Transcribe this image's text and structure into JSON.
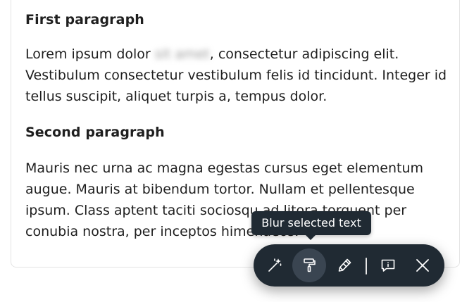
{
  "article": {
    "heading_1": "First paragraph",
    "p1_before": "Lorem ipsum dolor ",
    "p1_blurred": "sit amet",
    "p1_after": ", consectetur adipiscing elit. Vestibulum consectetur vestibulum felis id tincidunt. Integer id tellus suscipit, aliquet turpis a, tempus dolor.",
    "heading_2": "Second paragraph",
    "p2": "Mauris nec urna ac magna egestas cursus eget elementum augue. Mauris at bibendum tortor. Nullam et pellentesque ipsum. Class aptent taciti sociosqu ad litora torquent per conubia nostra, per inceptos himenaeos."
  },
  "tooltip": {
    "text": "Blur selected text"
  },
  "toolbar": {
    "buttons": [
      {
        "icon": "magic-wand-icon",
        "active": false
      },
      {
        "icon": "paint-roller-icon",
        "active": true
      },
      {
        "icon": "pencil-icon",
        "active": false
      },
      {
        "icon": "feedback-icon",
        "active": false
      },
      {
        "icon": "close-icon",
        "active": false
      }
    ],
    "colors": {
      "background": "#202a33",
      "active_background": "#3a4551",
      "icon": "#ffffff"
    }
  }
}
